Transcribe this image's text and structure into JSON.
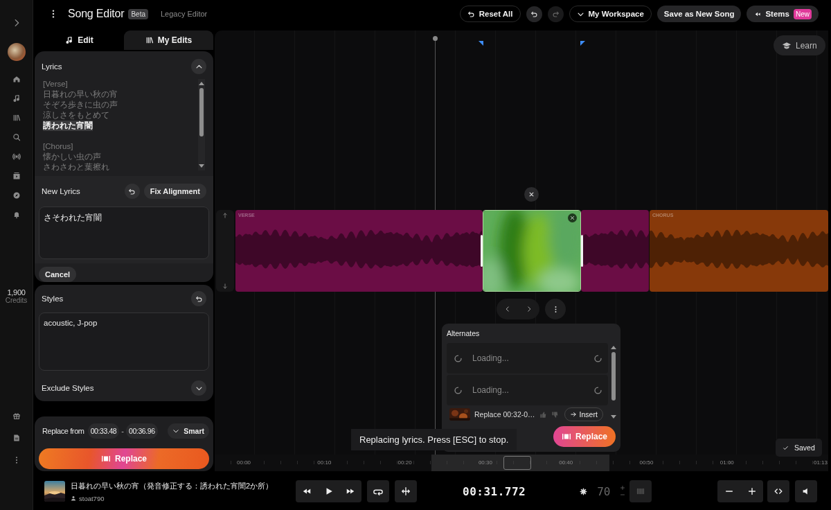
{
  "header": {
    "title": "Song Editor",
    "badge": "Beta",
    "link": "Legacy Editor",
    "actions": [
      {
        "kind": "reset",
        "label": "Reset All"
      },
      {
        "kind": "undo",
        "disabled": false
      },
      {
        "kind": "redo",
        "disabled": true
      },
      {
        "kind": "workspace",
        "label": "My Workspace"
      },
      {
        "kind": "save",
        "label": "Save as New Song"
      },
      {
        "kind": "stems",
        "label": "Stems",
        "badge": "New"
      }
    ]
  },
  "sidebar": {
    "credits": "1,900",
    "credits_label": "Credits"
  },
  "tabs": [
    {
      "label": "Edit",
      "selected": true
    },
    {
      "label": "My Edits",
      "selected": false
    }
  ],
  "lyrics": {
    "title": "Lyrics",
    "sections": [
      {
        "header": "[Verse]",
        "lines": [
          {
            "text": "日暮れの早い秋の宵",
            "selected": false
          },
          {
            "text": "そぞろ歩きに虫の声",
            "selected": false
          },
          {
            "text": "涼しさをもとめて",
            "selected": false
          },
          {
            "text": "誘われた宵闇",
            "selected": true
          }
        ]
      },
      {
        "header": "[Chorus]",
        "lines": [
          {
            "text": "懐かしい虫の声",
            "selected": false
          },
          {
            "text": "さわさわと葉擦れ",
            "selected": false
          }
        ]
      }
    ]
  },
  "new_lyrics": {
    "label": "New Lyrics",
    "action": "Fix Alignment",
    "value": "さそわれた宵闇",
    "cancel": "Cancel"
  },
  "styles": {
    "label": "Styles",
    "value": "acoustic, J-pop",
    "exclude": "Exclude Styles"
  },
  "replace": {
    "label": "Replace from",
    "start": "00:33.48",
    "separator": "-",
    "end": "00:36.96",
    "mode": "Smart",
    "button": "Replace"
  },
  "timeline": {
    "learn": "Learn",
    "clips": [
      {
        "kind": "section",
        "label": "VERSE",
        "color": "#6b0d45"
      },
      {
        "kind": "section",
        "label": "CHORUS",
        "color": "#87390a"
      }
    ],
    "alternates": {
      "title": "Alternates",
      "items": [
        {
          "kind": "loading",
          "text": "Loading..."
        },
        {
          "kind": "loading",
          "text": "Loading..."
        },
        {
          "kind": "result",
          "text": "Replace 00:32-0…",
          "action": "Insert"
        }
      ]
    },
    "toast": "Replacing lyrics. Press [ESC] to stop.",
    "replace_button": "Replace",
    "saved": "Saved",
    "ruler": [
      "00:00",
      "00:10",
      "00:20",
      "00:30",
      "00:40",
      "00:50",
      "01:00",
      "01:13"
    ]
  },
  "player": {
    "title": "日暮れの早い秋の宵（発音修正する：誘われた宵闇2か所）",
    "artist": "stoat790",
    "time": "00:31.772",
    "bpm": "70"
  }
}
